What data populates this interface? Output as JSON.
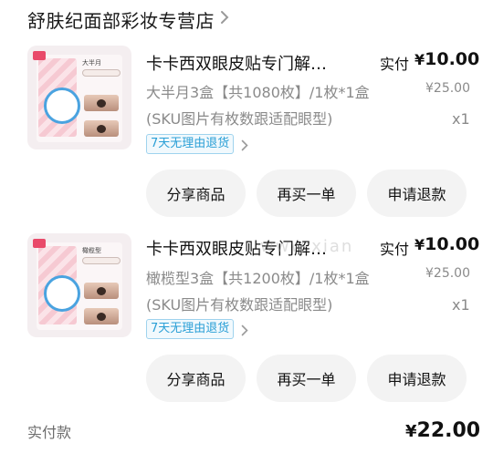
{
  "shop": {
    "name": "舒肤纪面部彩妆专营店"
  },
  "orders": [
    {
      "title": "卡卡西双眼皮贴专门解…",
      "paid_label": "实付",
      "paid_yen": "¥",
      "paid_value": "10.00",
      "original_price": "¥25.00",
      "spec": "大半月3盒【共1080枚】/1枚*1盒",
      "note": "(SKU图片有枚数跟适配眼型)",
      "qty": "x1",
      "badge": "7天无理由退货",
      "thumb_label": "大半月",
      "buttons": {
        "share": "分享商品",
        "rebuy": "再买一单",
        "refund": "申请退款"
      }
    },
    {
      "title": "卡卡西双眼皮贴专门解…",
      "paid_label": "实付",
      "paid_yen": "¥",
      "paid_value": "10.00",
      "original_price": "¥25.00",
      "spec": "橄榄型3盒【共1200枚】/1枚*1盒",
      "note": "(SKU图片有枚数跟适配眼型)",
      "qty": "x1",
      "badge": "7天无理由退货",
      "thumb_label": "橄榄型",
      "buttons": {
        "share": "分享商品",
        "rebuy": "再买一单",
        "refund": "申请退款"
      }
    }
  ],
  "footer": {
    "label": "实付款",
    "total_yen": "¥",
    "total_value": "22.00"
  },
  "watermark": "www.xian"
}
